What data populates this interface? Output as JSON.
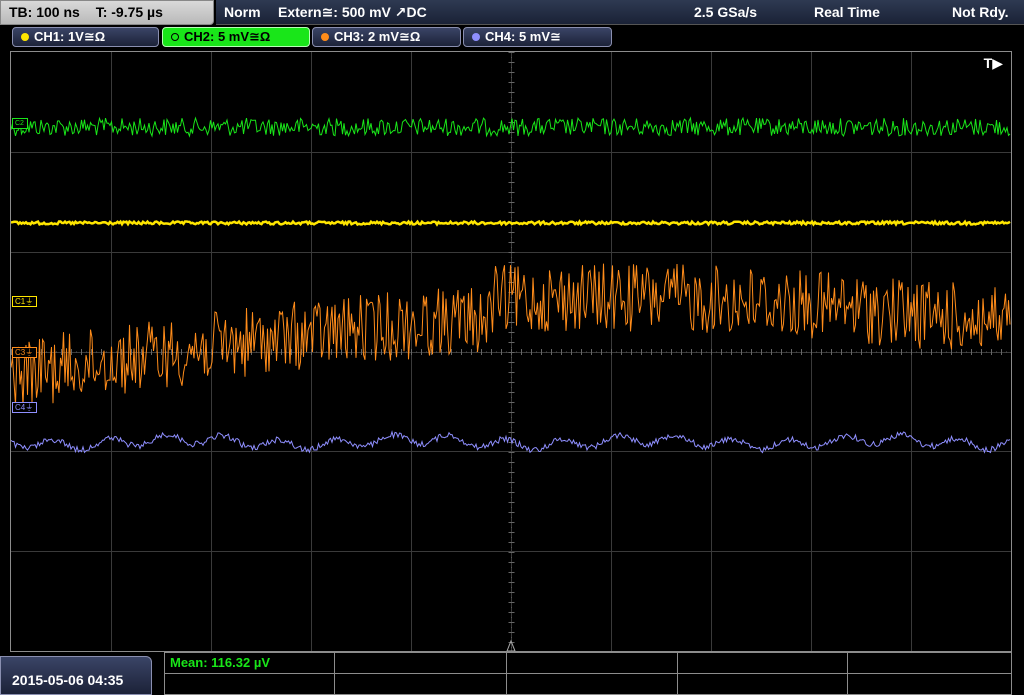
{
  "status": {
    "timebase": "TB: 100 ns",
    "trigger_time": "T: -9.75 µs",
    "acq_mode": "Norm",
    "trigger_source": "Extern≅: 500 mV ↗DC",
    "sample_rate": "2.5 GSa/s",
    "realtime": "Real Time",
    "trigger_state": "Not Rdy."
  },
  "channels": [
    {
      "label": "CH1: 1V≅Ω",
      "color": "#ffe600",
      "active": false
    },
    {
      "label": "CH2: 5 mV≅Ω",
      "color": "#19e619",
      "active": true
    },
    {
      "label": "CH3: 2 mV≅Ω",
      "color": "#ff8c1a",
      "active": false
    },
    {
      "label": "CH4: 5 mV≅",
      "color": "#8f8fff",
      "active": false
    }
  ],
  "marker_labels": {
    "c1": "C1⏚",
    "c3": "C3⏚",
    "c4": "C4⏚",
    "c2": "C2"
  },
  "trigger_marker": "T▶",
  "measurement": "Mean: 116.32 µV",
  "datetime": "2015-05-06  04:35",
  "colors": {
    "ch1": "#ffe600",
    "ch2": "#19e619",
    "ch3": "#ff8c1a",
    "ch4": "#8f8fff",
    "grid": "#3a3a3a"
  },
  "icons": {
    "trigger_position": "triangle-icon",
    "trigger_arrow": "play-icon"
  }
}
